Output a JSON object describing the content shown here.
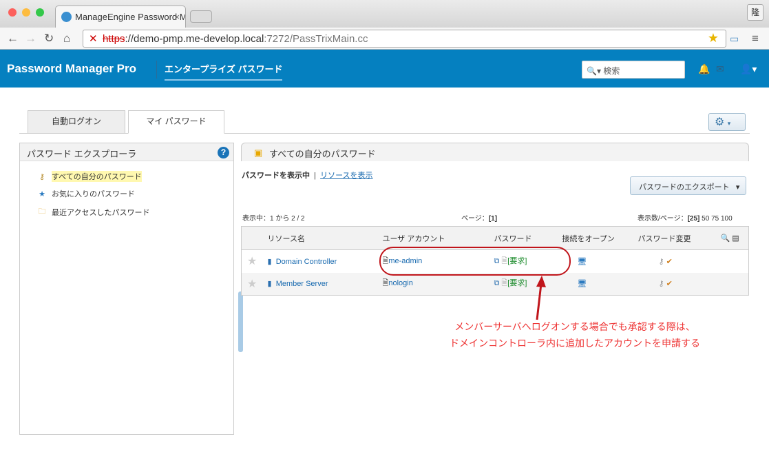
{
  "browser": {
    "tab_title": "ManageEngine Password M",
    "url_scheme": "https",
    "url_host": "://demo-pmp.me-develop.local",
    "url_path": ":7272/PassTrixMain.cc",
    "ime": "隆"
  },
  "header": {
    "logo": "Password Manager Pro",
    "nav": "エンタープライズ パスワード",
    "search_placeholder": "検索"
  },
  "tabs": [
    "自動ログオン",
    "マイ パスワード"
  ],
  "explorer": {
    "title": "パスワード エクスプローラ",
    "help": "?",
    "items": [
      "すべての自分のパスワード",
      "お気に入りのパスワード",
      "最近アクセスしたパスワード"
    ]
  },
  "main": {
    "title": "すべての自分のパスワード",
    "view_passwords": "パスワードを表示中",
    "separator": "|",
    "view_resources": "リソースを表示",
    "export": "パスワードのエクスポート",
    "showing": "表示中：1 から 2 / 2",
    "page": "ページ：",
    "page_num": "[1]",
    "per_page": "表示数/ページ：",
    "per_page_sel": "[25]",
    "per_page_opts": "50 75 100",
    "columns": [
      "リソース名",
      "ユーザ アカウント",
      "パスワード",
      "接続をオープン",
      "パスワード変更"
    ],
    "rows": [
      {
        "resource": "Domain Controller",
        "account": "me-admin",
        "request": "[要求]"
      },
      {
        "resource": "Member Server",
        "account": "nologin",
        "request": "[要求]"
      }
    ]
  },
  "annotation": {
    "line1": "メンバーサーバへログオンする場合でも承認する際は、",
    "line2": "ドメインコントローラ内に追加したアカウントを申請する"
  },
  "colors": {
    "header": "#0580c0",
    "annotation": "#c0151b"
  }
}
